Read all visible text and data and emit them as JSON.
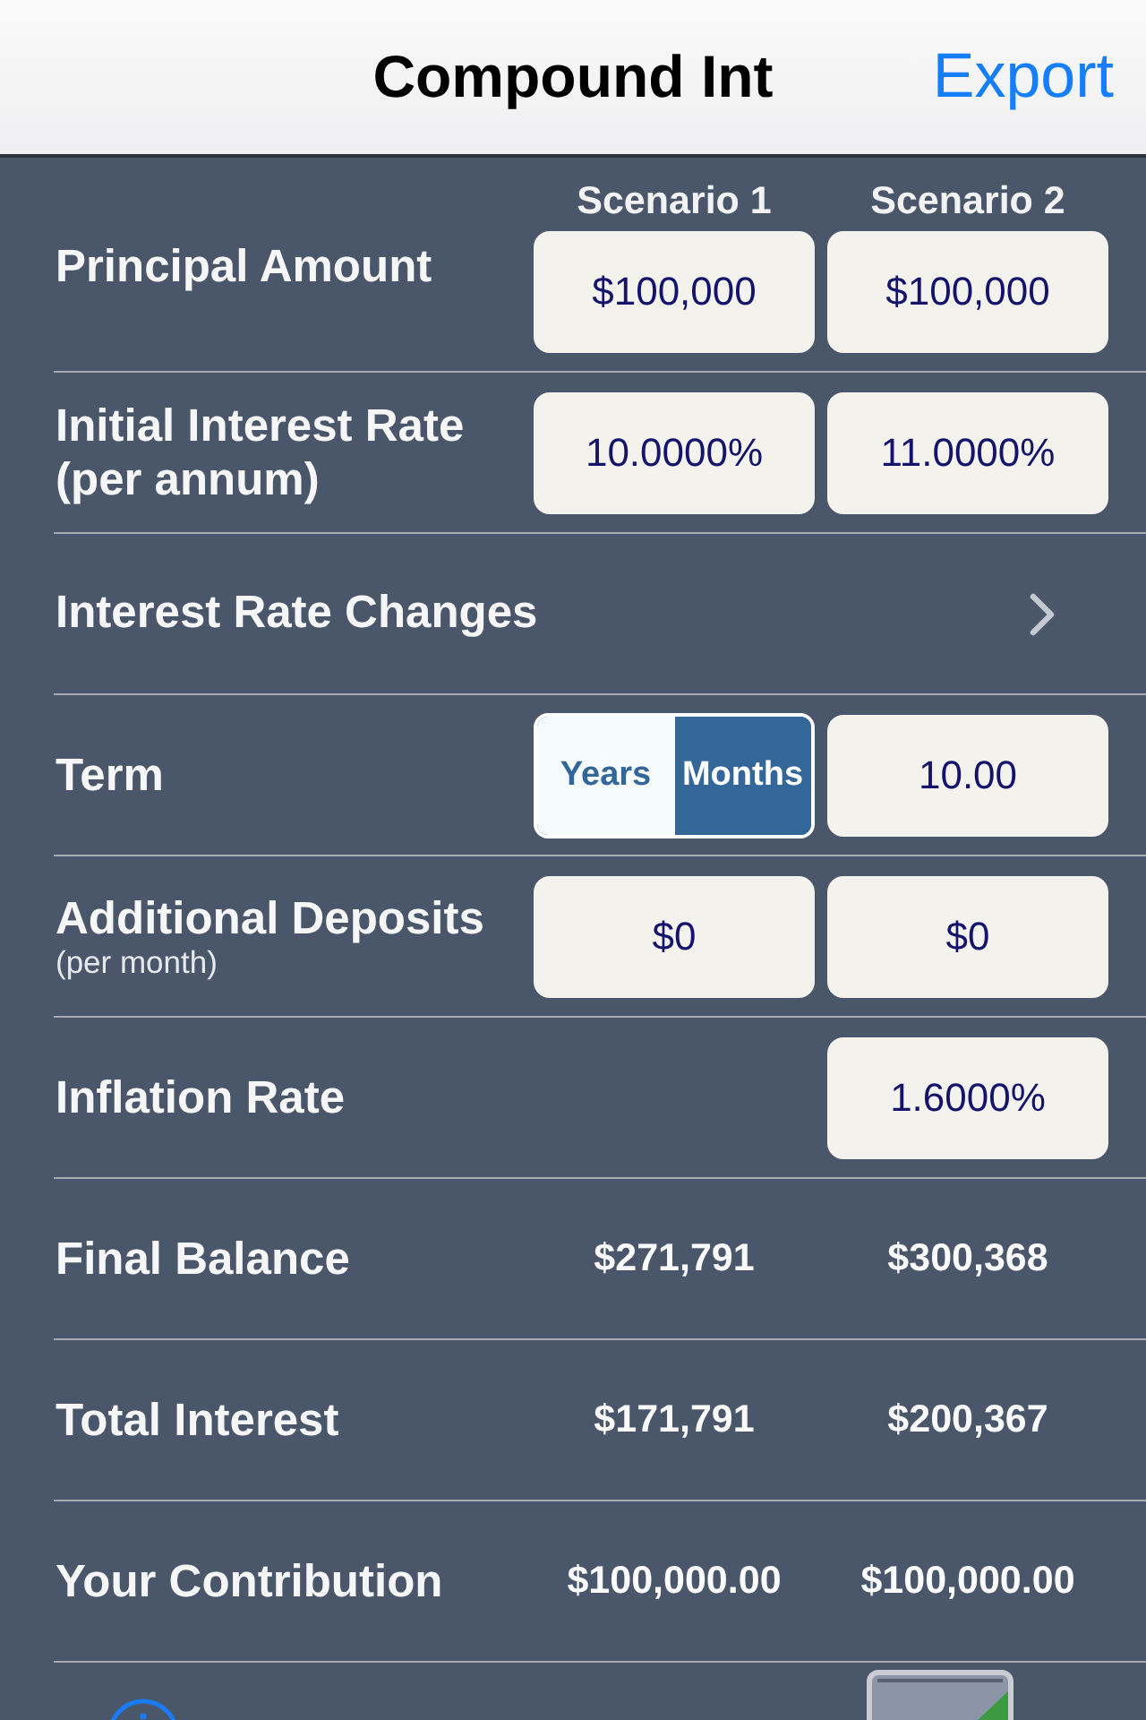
{
  "nav_bar": {
    "title": "Compound Int",
    "action": "Export"
  },
  "rows": [
    {
      "kind": "inputs",
      "label": "Principal Amount",
      "headers": [
        "Scenario 1",
        "Scenario 2"
      ],
      "values": [
        "$100,000",
        "$100,000"
      ]
    },
    {
      "kind": "inputs",
      "label": "Initial Interest Rate (per annum)",
      "values": [
        "10.0000%",
        "11.0000%"
      ]
    },
    {
      "kind": "link",
      "label": "Interest Rate Changes"
    },
    {
      "kind": "term",
      "label": "Term",
      "segments": [
        {
          "label": "Years",
          "selected": false
        },
        {
          "label": "Months",
          "selected": true
        }
      ],
      "value": "10.00"
    },
    {
      "kind": "inputs",
      "label": "Additional Deposits",
      "note": "(per month)",
      "values": [
        "$0",
        "$0"
      ]
    },
    {
      "kind": "single_input",
      "label": "Inflation Rate",
      "value": "1.6000%"
    },
    {
      "kind": "result",
      "label": "Final Balance",
      "values": [
        "$271,791",
        "$300,368"
      ]
    },
    {
      "kind": "result",
      "label": "Total Interest",
      "values": [
        "$171,791",
        "$200,367"
      ]
    },
    {
      "kind": "result",
      "label": "Your Contribution",
      "values": [
        "$100,000.00",
        "$100,000.00"
      ]
    }
  ]
}
